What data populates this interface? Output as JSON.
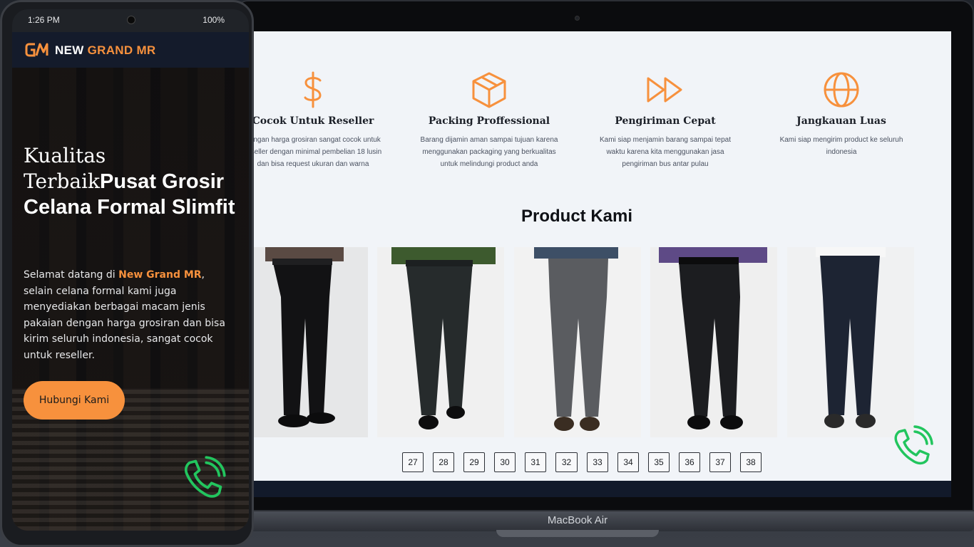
{
  "phone": {
    "status_time": "1:26 PM",
    "status_battery": "100%",
    "brand_part1": "NEW",
    "brand_part2": "GRAND MR",
    "hero_title_serif": "Kualitas Terbaik",
    "hero_title_bold": "Pusat Grosir Celana Formal Slimfit",
    "lead_prefix": "Selamat datang di",
    "lead_brand": "New Grand MR",
    "lead_suffix": ", selain celana formal kami juga menyediakan berbagai macam jenis pakaian dengan harga grosiran dan bisa kirim seluruh indonesia, sangat cocok untuk reseller.",
    "cta_label": "Hubungi Kami"
  },
  "laptop": {
    "device_label": "MacBook Air",
    "features": [
      {
        "icon": "dollar-icon",
        "title": "Cocok Untuk Reseller",
        "text": "dengan harga grosiran sangat cocok untuk reseller dengan minimal pembelian 18 lusin dan bisa request ukuran dan warna"
      },
      {
        "icon": "box-icon",
        "title": "Packing Proffessional",
        "text": "Barang dijamin aman sampai tujuan karena menggunakan packaging yang berkualitas untuk melindungi product anda"
      },
      {
        "icon": "fast-forward-icon",
        "title": "Pengiriman Cepat",
        "text": "Kami siap menjamin barang sampai tepat waktu karena kita menggunakan jasa pengiriman bus antar pulau"
      },
      {
        "icon": "globe-icon",
        "title": "Jangkauan Luas",
        "text": "Kami siap mengirim product ke seluruh indonesia"
      }
    ],
    "section_title": "Product Kami",
    "sizes": [
      "27",
      "28",
      "29",
      "30",
      "31",
      "32",
      "33",
      "34",
      "35",
      "36",
      "37",
      "38"
    ]
  },
  "colors": {
    "accent": "#f7913d",
    "navy": "#141b2b",
    "whatsapp": "#22c55e"
  }
}
